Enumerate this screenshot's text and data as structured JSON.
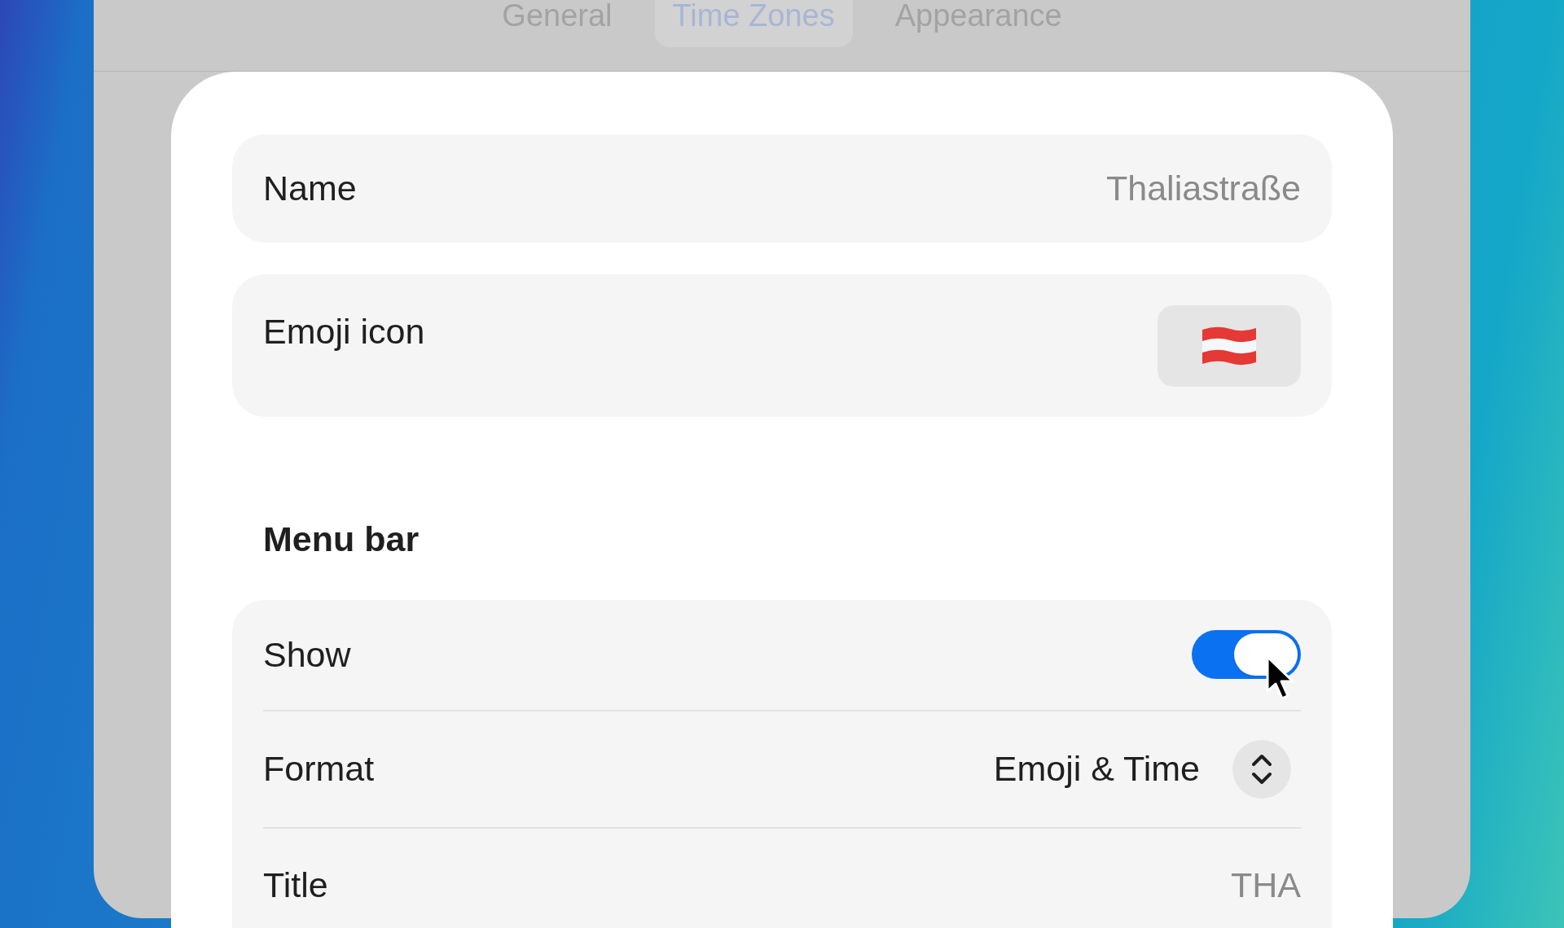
{
  "tabs": [
    {
      "label": "General",
      "selected": false
    },
    {
      "label": "Time Zones",
      "selected": true
    },
    {
      "label": "Appearance",
      "selected": false
    }
  ],
  "name": {
    "label": "Name",
    "value": "Thaliastraße"
  },
  "emoji_icon": {
    "label": "Emoji icon"
  },
  "menu_bar": {
    "heading": "Menu bar",
    "show": {
      "label": "Show",
      "on": true
    },
    "format": {
      "label": "Format",
      "value": "Emoji & Time"
    },
    "title": {
      "label": "Title",
      "value": "THA"
    }
  }
}
